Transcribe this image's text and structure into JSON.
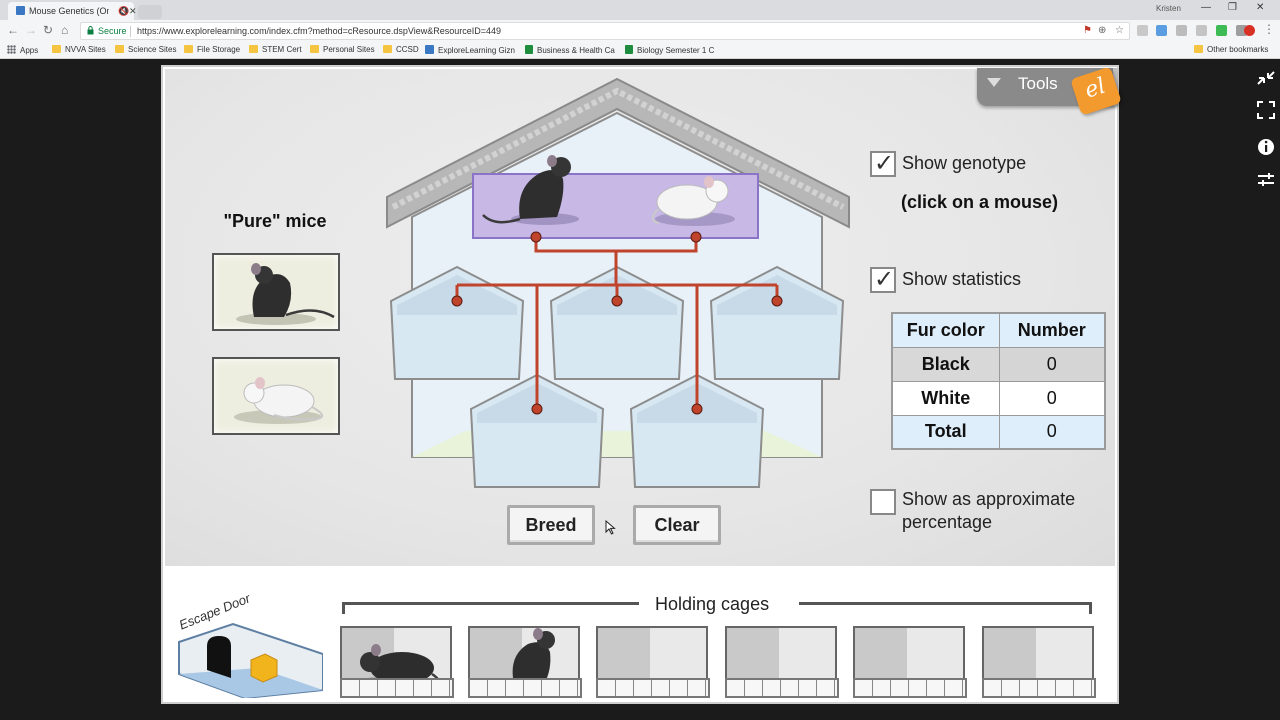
{
  "browser": {
    "tab_title": "Mouse Genetics (One",
    "tab_mute": "🔇",
    "tab_close": "✕",
    "profile_name": "Kristen",
    "window_controls": {
      "minimize": "—",
      "restore": "❐",
      "close": "✕"
    },
    "secure_label": "Secure",
    "url": "https://www.explorelearning.com/index.cfm?method=cResource.dspView&ResourceID=449",
    "bookmarks": [
      {
        "label": "Apps",
        "icon": "grid-icon"
      },
      {
        "label": "NVVA Sites",
        "icon": "folder-icon"
      },
      {
        "label": "Science Sites",
        "icon": "folder-icon"
      },
      {
        "label": "File Storage",
        "icon": "folder-icon"
      },
      {
        "label": "STEM Cert",
        "icon": "folder-icon"
      },
      {
        "label": "Personal Sites",
        "icon": "folder-icon"
      },
      {
        "label": "CCSD",
        "icon": "folder-icon"
      },
      {
        "label": "ExploreLearning Gizn",
        "icon": "explorelearning-icon"
      },
      {
        "label": "Business & Health Ca",
        "icon": "sheets-icon"
      },
      {
        "label": "Biology Semester 1 C",
        "icon": "sheets-icon"
      }
    ],
    "other_bookmarks": "Other bookmarks"
  },
  "gizmo": {
    "tools_label": "Tools",
    "logo_text": "el",
    "pure_mice_title": "\"Pure\" mice",
    "show_genotype": {
      "label": "Show genotype",
      "checked": true
    },
    "click_hint": "(click on a mouse)",
    "show_statistics": {
      "label": "Show statistics",
      "checked": true
    },
    "stats": {
      "col_fur": "Fur color",
      "col_number": "Number",
      "rows": [
        {
          "label": "Black",
          "value": "0"
        },
        {
          "label": "White",
          "value": "0"
        },
        {
          "label": "Total",
          "value": "0"
        }
      ]
    },
    "show_percentage": {
      "label_line1": "Show as approximate",
      "label_line2": "percentage",
      "checked": false
    },
    "breed_label": "Breed",
    "clear_label": "Clear",
    "escape_door_label": "Escape Door",
    "holding_cages_label": "Holding cages",
    "holding_cages": [
      "black-mouse-lying",
      "black-mouse-sitting",
      "empty",
      "empty",
      "empty",
      "empty"
    ]
  },
  "colors": {
    "pedigree_line": "#c0432c",
    "parent_highlight": "#c7b8e6",
    "cage_glass": "#dcebf5"
  }
}
